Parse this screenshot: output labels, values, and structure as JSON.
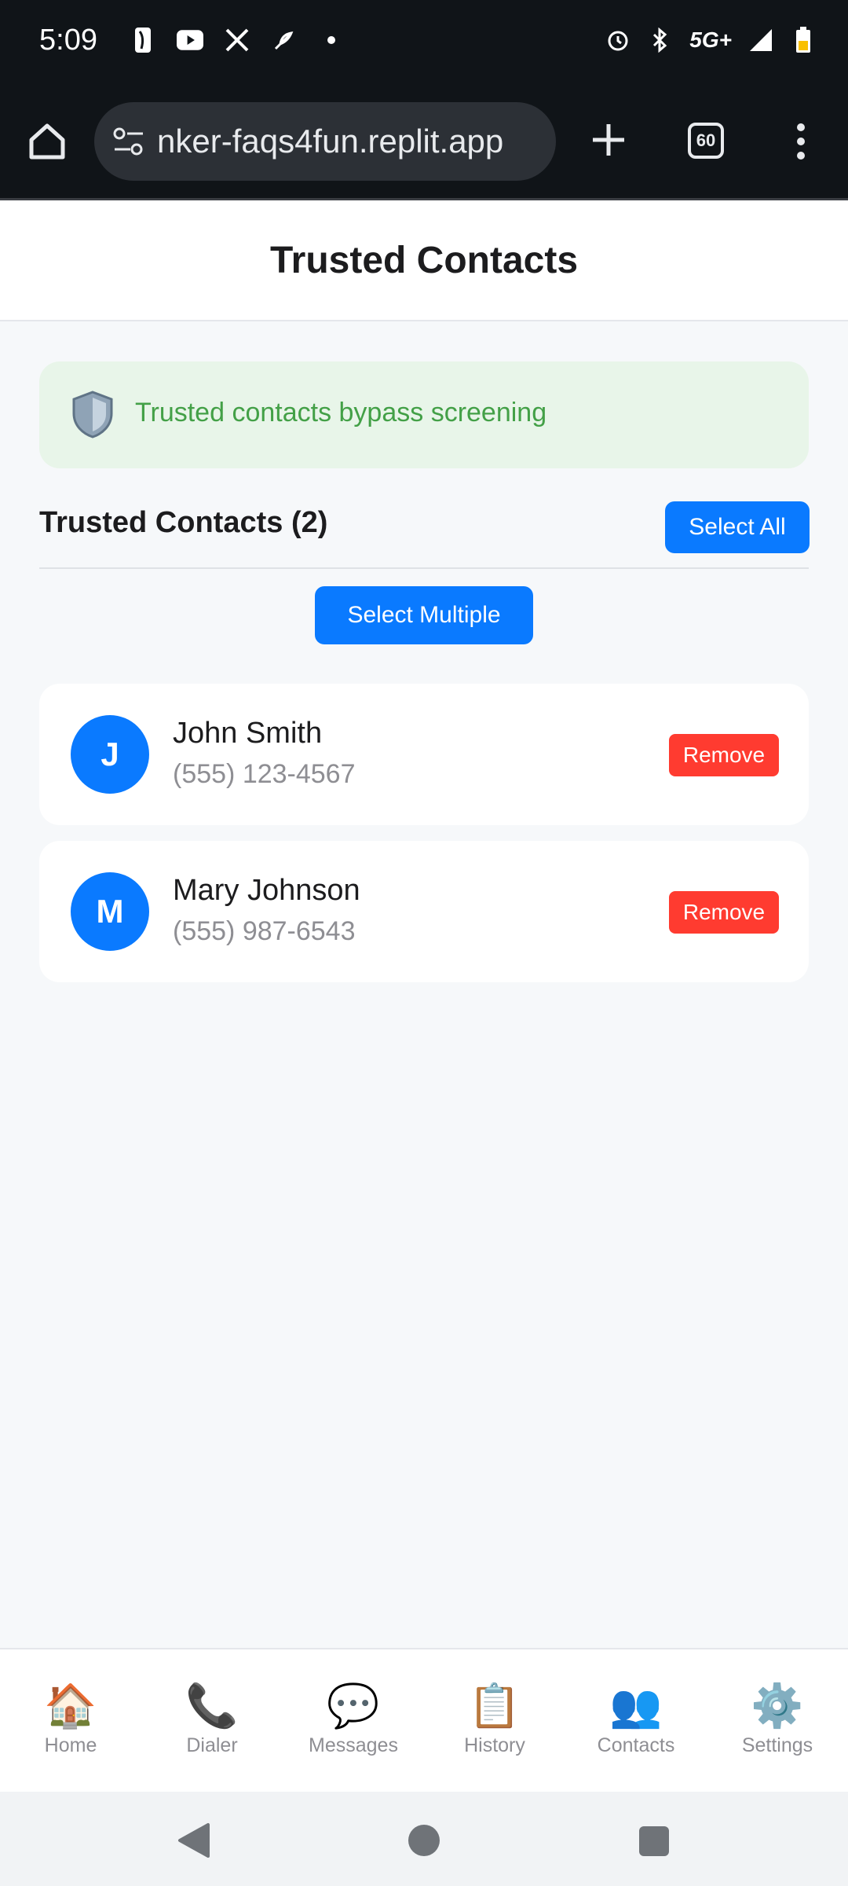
{
  "status_bar": {
    "time": "5:09",
    "left_icons": [
      "nba-icon",
      "youtube-icon",
      "x-icon",
      "feather-icon",
      "dot-icon"
    ],
    "network": "5G+",
    "right_icons": [
      "alarm-icon",
      "bluetooth-icon",
      "signal-icon",
      "battery-icon"
    ]
  },
  "browser": {
    "url": "nker-faqs4fun.replit.app",
    "tab_count": "60"
  },
  "header": {
    "title": "Trusted Contacts"
  },
  "banner": {
    "icon": "shield-icon",
    "text": "Trusted contacts bypass screening",
    "color": "#43a047"
  },
  "section": {
    "title": "Trusted Contacts (2)",
    "select_all_label": "Select All",
    "select_multiple_label": "Select Multiple"
  },
  "contacts": [
    {
      "initial": "J",
      "name": "John Smith",
      "phone": "(555) 123-4567",
      "remove_label": "Remove"
    },
    {
      "initial": "M",
      "name": "Mary Johnson",
      "phone": "(555) 987-6543",
      "remove_label": "Remove"
    }
  ],
  "bottom_nav": [
    {
      "icon": "🏠",
      "label": "Home"
    },
    {
      "icon": "📞",
      "label": "Dialer"
    },
    {
      "icon": "💬",
      "label": "Messages"
    },
    {
      "icon": "📋",
      "label": "History"
    },
    {
      "icon": "👥",
      "label": "Contacts"
    },
    {
      "icon": "⚙️",
      "label": "Settings"
    }
  ],
  "colors": {
    "primary": "#0a7aff",
    "danger": "#ff3b30",
    "success_bg": "#e8f5e9"
  }
}
